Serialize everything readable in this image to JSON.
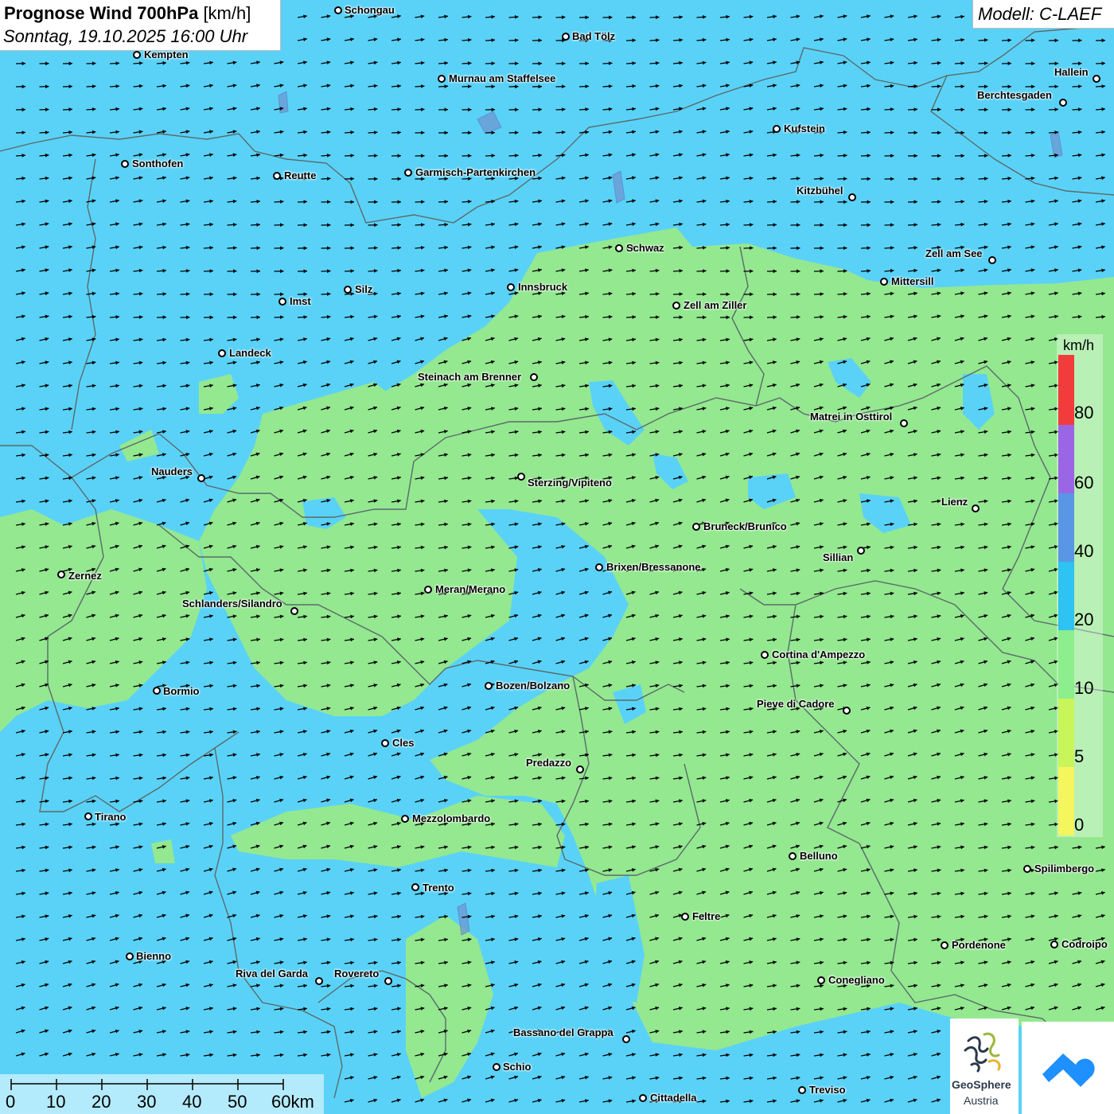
{
  "header": {
    "title_bold": "Prognose Wind 700hPa",
    "title_unit": "[km/h]",
    "datetime": "Sonntag, 19.10.2025 16:00 Uhr",
    "model": "Modell: C-LAEF"
  },
  "legend": {
    "unit": "km/h",
    "labels": [
      "0",
      "5",
      "10",
      "20",
      "40",
      "60",
      "80"
    ],
    "colors": [
      "#f5f55e",
      "#c8f55a",
      "#8cee8c",
      "#2ec3f2",
      "#5a96e6",
      "#9b66e6",
      "#f23c3c"
    ]
  },
  "scalebar": {
    "labels": [
      "0",
      "10",
      "20",
      "30",
      "40",
      "50",
      "60km"
    ]
  },
  "colors": {
    "blue_field": "#5ad2f8",
    "green_field": "#94e890",
    "border_line": "#5a6a6a"
  },
  "logos": {
    "geosphere_line1": "GeoSphere",
    "geosphere_line2": "Austria",
    "icon_names": [
      "geosphere-logo-icon",
      "cloud-logo-icon"
    ]
  },
  "cities": [
    {
      "name": "Schongau"
    },
    {
      "name": "Bad Tölz"
    },
    {
      "name": "Kempten"
    },
    {
      "name": "Murnau am Staffelsee"
    },
    {
      "name": "Hallein"
    },
    {
      "name": "Berchtesgaden"
    },
    {
      "name": "Kufstein"
    },
    {
      "name": "Sonthofen"
    },
    {
      "name": "Reutte"
    },
    {
      "name": "Garmisch-Partenkirchen"
    },
    {
      "name": "Kitzbühel"
    },
    {
      "name": "Schwaz"
    },
    {
      "name": "Zell am See"
    },
    {
      "name": "Mittersill"
    },
    {
      "name": "Innsbruck"
    },
    {
      "name": "Silz"
    },
    {
      "name": "Imst"
    },
    {
      "name": "Zell am Ziller"
    },
    {
      "name": "Landeck"
    },
    {
      "name": "Steinach am Brenner"
    },
    {
      "name": "Matrei in Osttirol"
    },
    {
      "name": "Nauders"
    },
    {
      "name": "Sterzing/Vipiteno"
    },
    {
      "name": "Lienz"
    },
    {
      "name": "Bruneck/Brunico"
    },
    {
      "name": "Sillian"
    },
    {
      "name": "Zernez"
    },
    {
      "name": "Brixen/Bressanone"
    },
    {
      "name": "Meran/Merano"
    },
    {
      "name": "Schlanders/Silandro"
    },
    {
      "name": "Cortina d'Ampezzo"
    },
    {
      "name": "Bozen/Bolzano"
    },
    {
      "name": "Bormio"
    },
    {
      "name": "Pieve di Cadore"
    },
    {
      "name": "Cles"
    },
    {
      "name": "Predazzo"
    },
    {
      "name": "Tirano"
    },
    {
      "name": "Mezzolombardo"
    },
    {
      "name": "Belluno"
    },
    {
      "name": "Spilimbergo"
    },
    {
      "name": "Trento"
    },
    {
      "name": "Feltre"
    },
    {
      "name": "Pordenone"
    },
    {
      "name": "Codroipo"
    },
    {
      "name": "Bienno"
    },
    {
      "name": "Riva del Garda"
    },
    {
      "name": "Rovereto"
    },
    {
      "name": "Conegliano"
    },
    {
      "name": "Bassano del Grappa"
    },
    {
      "name": "Schio"
    },
    {
      "name": "Treviso"
    },
    {
      "name": "Cittadella"
    }
  ]
}
